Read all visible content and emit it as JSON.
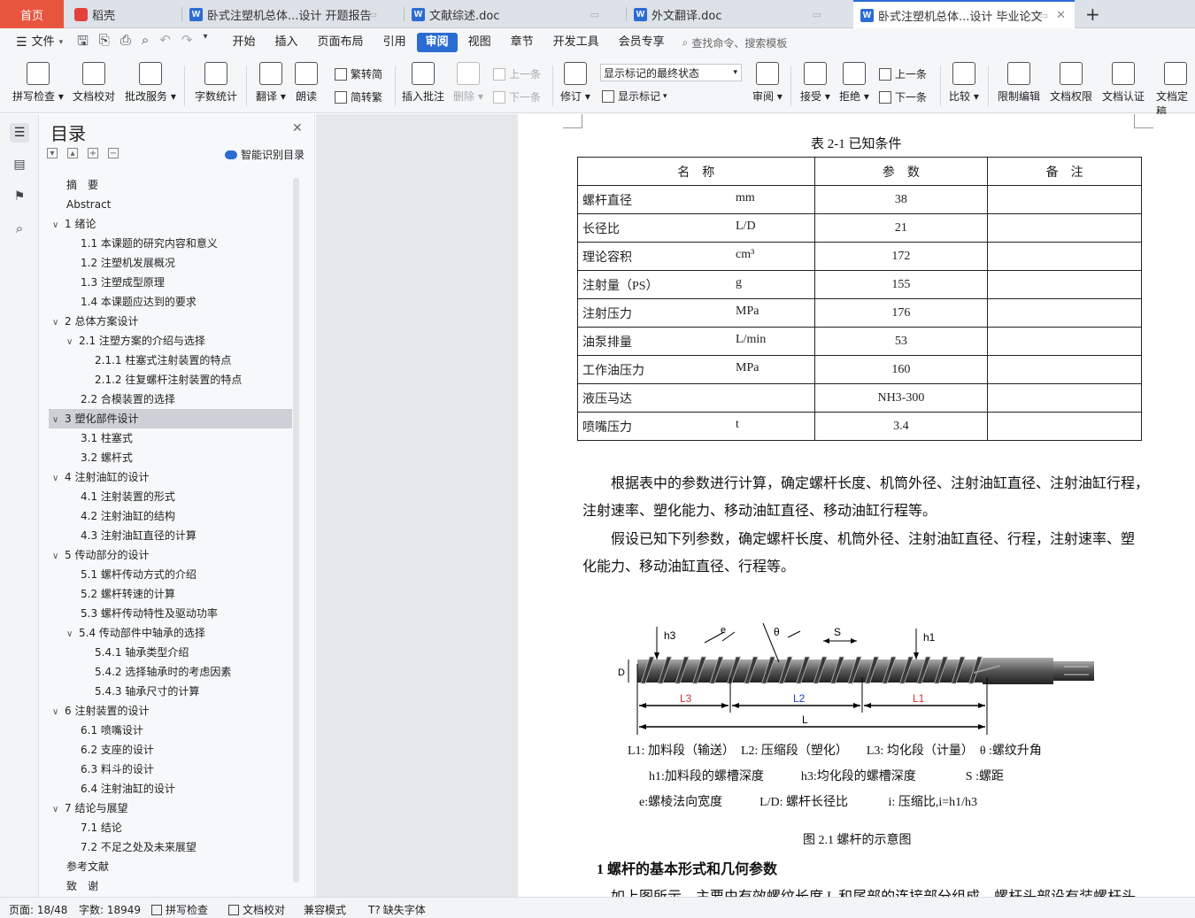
{
  "tabs": {
    "home": "首页",
    "daoke": "稻壳",
    "t1": "卧式注塑机总体...设计 开题报告",
    "t2": "文献综述.doc",
    "t3": "外文翻译.doc",
    "t4": "卧式注塑机总体...设计 毕业论文",
    "add": "+"
  },
  "menu": {
    "file": "文件",
    "items": [
      "开始",
      "插入",
      "页面布局",
      "引用",
      "审阅",
      "视图",
      "章节",
      "开发工具",
      "会员专享"
    ],
    "active": "审阅",
    "search": "查找命令、搜索模板"
  },
  "ribbon": {
    "spell": "拼写检查",
    "doccheck": "文档校对",
    "batch": "批改服务",
    "wordcount": "字数统计",
    "translate": "翻译",
    "read": "朗读",
    "trad": "繁转简",
    "simp": "简转繁",
    "insert_comment": "插入批注",
    "delete": "删除",
    "prev": "上一条",
    "next": "下一条",
    "revise": "修订",
    "markup_state": "显示标记的最终状态",
    "show_markup": "显示标记",
    "review": "审阅",
    "accept": "接受",
    "reject": "拒绝",
    "prev2": "上一条",
    "next2": "下一条",
    "compare": "比较",
    "restrict": "限制编辑",
    "perm": "文档权限",
    "auth": "文档认证",
    "custom": "文档定稿"
  },
  "toc": {
    "title": "目录",
    "smart": "智能识别目录",
    "items": [
      {
        "t": "摘　要",
        "lv": 0
      },
      {
        "t": "Abstract",
        "lv": 0
      },
      {
        "t": "1  绪论",
        "lv": 1,
        "c": true
      },
      {
        "t": "1.1  本课题的研究内容和意义",
        "lv": 2
      },
      {
        "t": "1.2  注塑机发展概况",
        "lv": 2
      },
      {
        "t": "1.3  注塑成型原理",
        "lv": 2
      },
      {
        "t": "1.4 本课题应达到的要求",
        "lv": 2
      },
      {
        "t": "2  总体方案设计",
        "lv": 1,
        "c": true
      },
      {
        "t": "2.1 注塑方案的介绍与选择",
        "lv": 2,
        "c": true
      },
      {
        "t": "2.1.1 柱塞式注射装置的特点",
        "lv": 3
      },
      {
        "t": "2.1.2 往复螺杆注射装置的特点",
        "lv": 3
      },
      {
        "t": "2.2 合模装置的选择",
        "lv": 2
      },
      {
        "t": "3  塑化部件设计",
        "lv": 1,
        "c": true,
        "sel": true
      },
      {
        "t": "3.1  柱塞式",
        "lv": 2
      },
      {
        "t": "3.2  螺杆式",
        "lv": 2
      },
      {
        "t": "4  注射油缸的设计",
        "lv": 1,
        "c": true
      },
      {
        "t": "4.1  注射装置的形式",
        "lv": 2
      },
      {
        "t": "4.2  注射油缸的结构",
        "lv": 2
      },
      {
        "t": "4.3  注射油缸直径的计算",
        "lv": 2
      },
      {
        "t": "5  传动部分的设计",
        "lv": 1,
        "c": true
      },
      {
        "t": "5.1  螺杆传动方式的介绍",
        "lv": 2
      },
      {
        "t": "5.2  螺杆转速的计算",
        "lv": 2
      },
      {
        "t": "5.3  螺杆传动特性及驱动功率",
        "lv": 2
      },
      {
        "t": "5.4 传动部件中轴承的选择",
        "lv": 2,
        "c": true
      },
      {
        "t": "5.4.1  轴承类型介绍",
        "lv": 3
      },
      {
        "t": "5.4.2  选择轴承时的考虑因素",
        "lv": 3
      },
      {
        "t": "5.4.3  轴承尺寸的计算",
        "lv": 3
      },
      {
        "t": "6  注射装置的设计",
        "lv": 1,
        "c": true
      },
      {
        "t": "6.1  喷嘴设计",
        "lv": 2
      },
      {
        "t": "6.2  支座的设计",
        "lv": 2
      },
      {
        "t": "6.3  料斗的设计",
        "lv": 2
      },
      {
        "t": "6.4 注射油缸的设计",
        "lv": 2
      },
      {
        "t": "7  结论与展望",
        "lv": 1,
        "c": true
      },
      {
        "t": "7.1 结论",
        "lv": 2
      },
      {
        "t": "7.2 不足之处及未来展望",
        "lv": 2
      },
      {
        "t": "参考文献",
        "lv": 0
      },
      {
        "t": "致　谢",
        "lv": 0
      }
    ]
  },
  "doc": {
    "table_caption": "表 2-1 已知条件",
    "headers": [
      "名　称",
      "参　数",
      "备　注"
    ],
    "rows": [
      [
        "螺杆直径",
        "mm",
        "38"
      ],
      [
        "长径比",
        "L/D",
        "21"
      ],
      [
        "理论容积",
        "cm³",
        "172"
      ],
      [
        "注射量（PS）",
        "g",
        "155"
      ],
      [
        "注射压力",
        "MPa",
        "176"
      ],
      [
        "油泵排量",
        "L/min",
        "53"
      ],
      [
        "工作油压力",
        "MPa",
        "160"
      ],
      [
        "液压马达",
        "",
        "NH3-300"
      ],
      [
        "喷嘴压力",
        "t",
        "3.4"
      ]
    ],
    "p1a": "根据表中的参数进行计算，确定螺杆长度、机筒外径、注射油缸直径、注射油缸行程，",
    "p1b": "注射速率、塑化能力、移动油缸直径、移动油缸行程等。",
    "p2a": "假设已知下列参数，确定螺杆长度、机筒外径、注射油缸直径、行程，注射速率、塑",
    "p2b": "化能力、移动油缸直径、行程等。",
    "fig_labels": {
      "h3": "h3",
      "e": "e",
      "theta": "θ",
      "s": "S",
      "h1": "h1",
      "d": "D",
      "l3": "L3",
      "l2": "L2",
      "l1": "L1",
      "l": "L"
    },
    "legend1": "L1: 加料段（输送）　L2: 压缩段（塑化）　　L3: 均化段（计量）　θ :螺纹升角",
    "legend2": "h1:加料段的螺槽深度　　　h3:均化段的螺槽深度　　　　S :螺距",
    "legend3": "e:螺棱法向宽度　　　L/D: 螺杆长径比　　　 i: 压缩比,i=h1/h3",
    "fig_caption": "图 2.1  螺杆的示意图",
    "heading": "1 螺杆的基本形式和几何参数",
    "partial": "如上图所示，主要由有效螺纹长度 L 和尾部的连接部分组成，螺杆头部设有装螺杆头"
  },
  "status": {
    "page": "页面: 18/48",
    "words": "字数: 18949",
    "spell": "拼写检查",
    "doccheck": "文档校对",
    "compat": "兼容模式",
    "font": "缺失字体"
  }
}
